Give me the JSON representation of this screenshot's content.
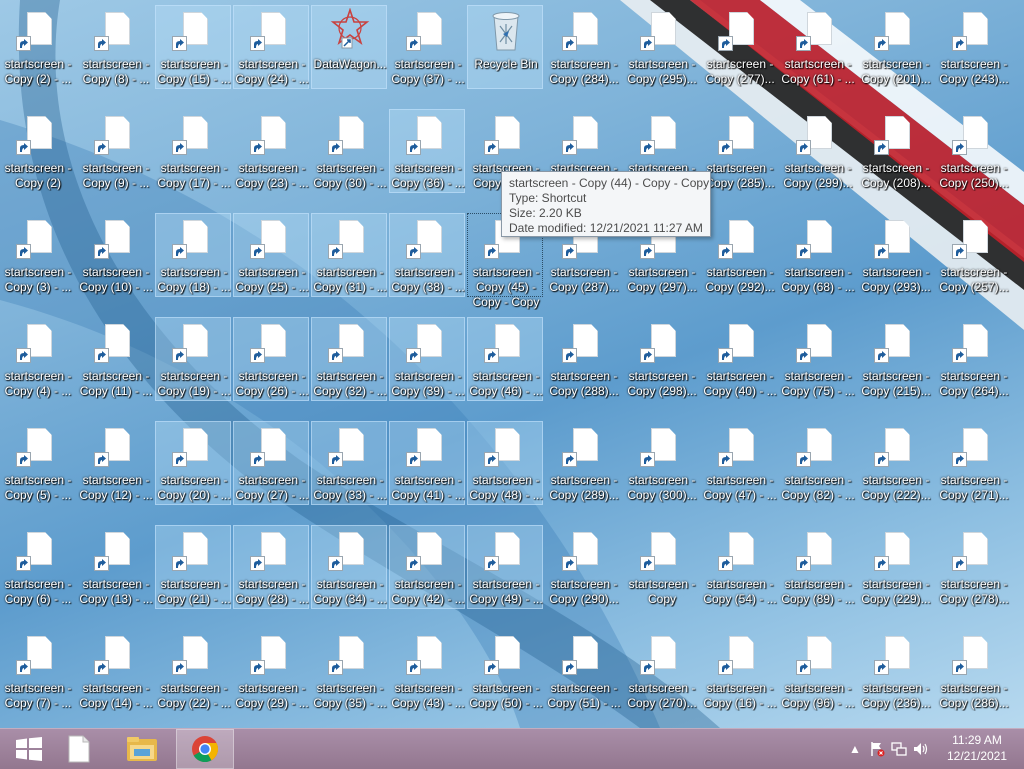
{
  "desktop": {
    "icons": [
      {
        "label": "startscreen -\nCopy (2) - ..."
      },
      {
        "label": "startscreen -\nCopy (2)"
      },
      {
        "label": "startscreen -\nCopy (3) - ..."
      },
      {
        "label": "startscreen -\nCopy (4) - ..."
      },
      {
        "label": "startscreen -\nCopy (5) - ..."
      },
      {
        "label": "startscreen -\nCopy (6) - ..."
      },
      {
        "label": "startscreen -\nCopy (7) - ..."
      },
      {
        "label": "startscreen -\nCopy (8) - ..."
      },
      {
        "label": "startscreen -\nCopy (9) - ..."
      },
      {
        "label": "startscreen -\nCopy (10) - ..."
      },
      {
        "label": "startscreen -\nCopy (11) - ..."
      },
      {
        "label": "startscreen -\nCopy (12) - ..."
      },
      {
        "label": "startscreen -\nCopy (13) - ..."
      },
      {
        "label": "startscreen -\nCopy (14) - ..."
      },
      {
        "label": "startscreen -\nCopy (15) - ..."
      },
      {
        "label": "startscreen -\nCopy (17) - ..."
      },
      {
        "label": "startscreen -\nCopy (18) - ..."
      },
      {
        "label": "startscreen -\nCopy (19) - ..."
      },
      {
        "label": "startscreen -\nCopy (20) - ..."
      },
      {
        "label": "startscreen -\nCopy (21) - ..."
      },
      {
        "label": "startscreen -\nCopy (22) - ..."
      },
      {
        "label": "startscreen -\nCopy (24) - ..."
      },
      {
        "label": "startscreen -\nCopy (23) - ..."
      },
      {
        "label": "startscreen -\nCopy (25) - ..."
      },
      {
        "label": "startscreen -\nCopy (26) - ..."
      },
      {
        "label": "startscreen -\nCopy (27) - ..."
      },
      {
        "label": "startscreen -\nCopy (28) - ..."
      },
      {
        "label": "startscreen -\nCopy (29) - ..."
      },
      {
        "label": "DataWagon..."
      },
      {
        "label": "startscreen -\nCopy (30) - ..."
      },
      {
        "label": "startscreen -\nCopy (31) - ..."
      },
      {
        "label": "startscreen -\nCopy (32) - ..."
      },
      {
        "label": "startscreen -\nCopy (33) - ..."
      },
      {
        "label": "startscreen -\nCopy (34) - ..."
      },
      {
        "label": "startscreen -\nCopy (35) - ..."
      },
      {
        "label": "startscreen -\nCopy (37) - ..."
      },
      {
        "label": "startscreen -\nCopy (36) - ..."
      },
      {
        "label": "startscreen -\nCopy (38) - ..."
      },
      {
        "label": "startscreen -\nCopy (39) - ..."
      },
      {
        "label": "startscreen -\nCopy (41) - ..."
      },
      {
        "label": "startscreen -\nCopy (42) - ..."
      },
      {
        "label": "startscreen -\nCopy (43) - ..."
      },
      {
        "label": "Recycle Bin"
      },
      {
        "label": "startscreen -\nCopy (44) ..."
      },
      {
        "label": "startscreen -\nCopy (45) -\nCopy - Copy"
      },
      {
        "label": "startscreen -\nCopy (46) - ..."
      },
      {
        "label": "startscreen -\nCopy (48) - ..."
      },
      {
        "label": "startscreen -\nCopy (49) - ..."
      },
      {
        "label": "startscreen -\nCopy (50) - ..."
      },
      {
        "label": "startscreen -\nCopy (284)..."
      },
      {
        "label": "startscreen -\nCopy (286)..."
      },
      {
        "label": "startscreen -\nCopy (287)..."
      },
      {
        "label": "startscreen -\nCopy (288)..."
      },
      {
        "label": "startscreen -\nCopy (289)..."
      },
      {
        "label": "startscreen -\nCopy (290)..."
      },
      {
        "label": "startscreen -\nCopy (51) - ..."
      },
      {
        "label": "startscreen -\nCopy (295)..."
      },
      {
        "label": "startscreen -\nCopy (296)..."
      },
      {
        "label": "startscreen -\nCopy (297)..."
      },
      {
        "label": "startscreen -\nCopy (298)..."
      },
      {
        "label": "startscreen -\nCopy (300)..."
      },
      {
        "label": "startscreen -\nCopy"
      },
      {
        "label": "startscreen -\nCopy (270)..."
      },
      {
        "label": "startscreen -\nCopy (277)..."
      },
      {
        "label": "startscreen -\nCopy (285)..."
      },
      {
        "label": "startscreen -\nCopy (292)..."
      },
      {
        "label": "startscreen -\nCopy (40) - ..."
      },
      {
        "label": "startscreen -\nCopy (47) - ..."
      },
      {
        "label": "startscreen -\nCopy (54) - ..."
      },
      {
        "label": "startscreen -\nCopy (16) - ..."
      },
      {
        "label": "startscreen -\nCopy (61) - ..."
      },
      {
        "label": "startscreen -\nCopy (299)..."
      },
      {
        "label": "startscreen -\nCopy (68) - ..."
      },
      {
        "label": "startscreen -\nCopy (75) - ..."
      },
      {
        "label": "startscreen -\nCopy (82) - ..."
      },
      {
        "label": "startscreen -\nCopy (89) - ..."
      },
      {
        "label": "startscreen -\nCopy (96) - ..."
      },
      {
        "label": "startscreen -\nCopy (201)..."
      },
      {
        "label": "startscreen -\nCopy (208)..."
      },
      {
        "label": "startscreen -\nCopy (293)..."
      },
      {
        "label": "startscreen -\nCopy (215)..."
      },
      {
        "label": "startscreen -\nCopy (222)..."
      },
      {
        "label": "startscreen -\nCopy (229)..."
      },
      {
        "label": "startscreen -\nCopy (236)..."
      },
      {
        "label": "startscreen -\nCopy (243)..."
      },
      {
        "label": "startscreen -\nCopy (250)..."
      },
      {
        "label": "startscreen -\nCopy (257)..."
      },
      {
        "label": "startscreen -\nCopy (264)..."
      },
      {
        "label": "startscreen -\nCopy (271)..."
      },
      {
        "label": "startscreen -\nCopy (278)..."
      },
      {
        "label": "startscreen -\nCopy (286)..."
      }
    ]
  },
  "tooltip": {
    "name": "startscreen - Copy (44) - Copy - Copy",
    "type": "Type: Shortcut",
    "size": "Size: 2.20 KB",
    "modified": "Date modified: 12/21/2021 11:27 AM"
  },
  "taskbar": {
    "start_icon": "windows-logo-icon",
    "pinned": [
      "file-icon",
      "file-explorer-icon",
      "chrome-icon"
    ],
    "clock_time": "11:29 AM",
    "clock_date": "12/21/2021",
    "tray": [
      "show-hidden-icons-chevron",
      "action-center-flag-icon",
      "network-icon",
      "volume-icon"
    ]
  }
}
